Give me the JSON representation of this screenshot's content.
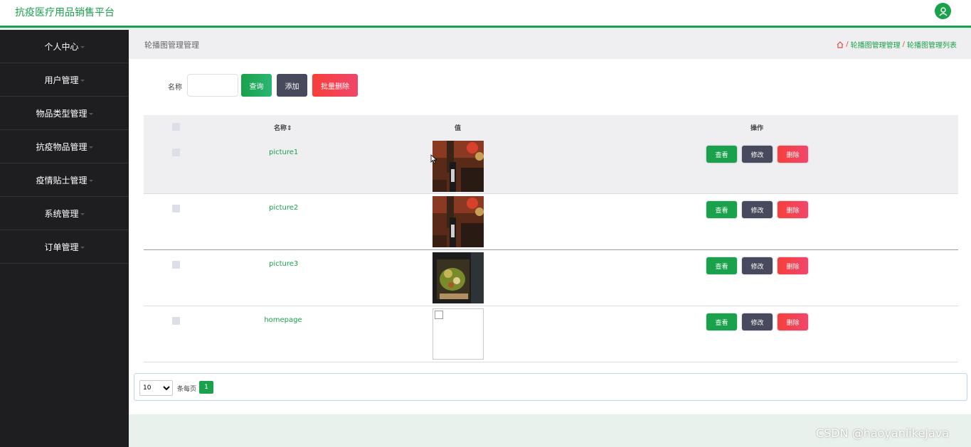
{
  "app": {
    "title": "抗疫医疗用品销售平台"
  },
  "sidebar": {
    "items": [
      {
        "label": "个人中心"
      },
      {
        "label": "用户管理"
      },
      {
        "label": "物品类型管理"
      },
      {
        "label": "抗疫物品管理"
      },
      {
        "label": "疫情贴士管理"
      },
      {
        "label": "系统管理"
      },
      {
        "label": "订单管理"
      }
    ]
  },
  "header": {
    "page_title": "轮播图管理管理",
    "breadcrumb": [
      "轮播图管理管理",
      "轮播图管理列表"
    ],
    "breadcrumb_sep": "/"
  },
  "search": {
    "label": "名称",
    "value": "",
    "query_btn": "查询",
    "add_btn": "添加",
    "batch_delete_btn": "批量删除"
  },
  "table": {
    "columns": {
      "name": "名称",
      "sort_icon": "⇕",
      "value": "值",
      "actions": "操作"
    },
    "rows": [
      {
        "name": "picture1",
        "image": "boots-photo"
      },
      {
        "name": "picture2",
        "image": "boots-photo"
      },
      {
        "name": "picture3",
        "image": "food-photo"
      },
      {
        "name": "homepage",
        "image": "broken-image"
      }
    ],
    "row_actions": {
      "view": "查看",
      "edit": "修改",
      "delete": "删除"
    }
  },
  "pager": {
    "page_size": "10",
    "per_page_label": "条每页",
    "current_page": "1"
  },
  "watermark": "CSDN @haoyanlikeJava",
  "colors": {
    "accent": "#1aa14b",
    "sidebar": "#1e1e20",
    "danger": "#f0466b",
    "dark_button": "#474a5d"
  }
}
